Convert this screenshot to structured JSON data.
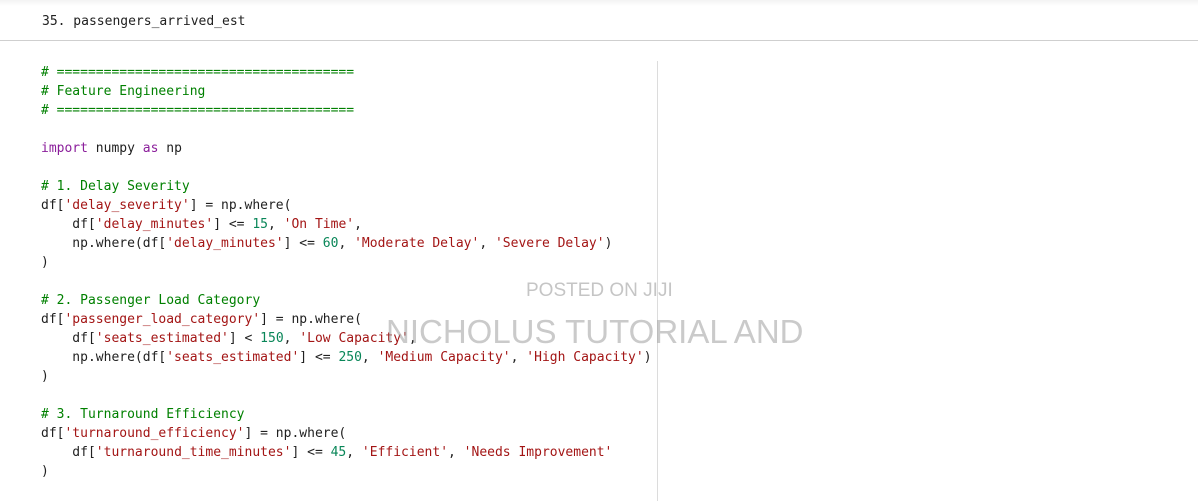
{
  "output_line": "35. passengers_arrived_est",
  "watermark": {
    "line1": "POSTED ON JIJI",
    "line2": "NICHOLUS TUTORIAL AND"
  },
  "code": [
    [
      [
        "c",
        "# ======================================"
      ]
    ],
    [
      [
        "c",
        "# Feature Engineering"
      ]
    ],
    [
      [
        "c",
        "# ======================================"
      ]
    ],
    [],
    [
      [
        "k",
        "import"
      ],
      [
        "p",
        " numpy "
      ],
      [
        "k",
        "as"
      ],
      [
        "p",
        " np"
      ]
    ],
    [],
    [
      [
        "c",
        "# 1. Delay Severity"
      ]
    ],
    [
      [
        "p",
        "df["
      ],
      [
        "s",
        "'delay_severity'"
      ],
      [
        "p",
        "] = np.where("
      ]
    ],
    [
      [
        "p",
        "    df["
      ],
      [
        "s",
        "'delay_minutes'"
      ],
      [
        "p",
        "] <= "
      ],
      [
        "n",
        "15"
      ],
      [
        "p",
        ", "
      ],
      [
        "s",
        "'On Time'"
      ],
      [
        "p",
        ","
      ]
    ],
    [
      [
        "p",
        "    np.where(df["
      ],
      [
        "s",
        "'delay_minutes'"
      ],
      [
        "p",
        "] <= "
      ],
      [
        "n",
        "60"
      ],
      [
        "p",
        ", "
      ],
      [
        "s",
        "'Moderate Delay'"
      ],
      [
        "p",
        ", "
      ],
      [
        "s",
        "'Severe Delay'"
      ],
      [
        "p",
        ")"
      ]
    ],
    [
      [
        "p",
        ")"
      ]
    ],
    [],
    [
      [
        "c",
        "# 2. Passenger Load Category"
      ]
    ],
    [
      [
        "p",
        "df["
      ],
      [
        "s",
        "'passenger_load_category'"
      ],
      [
        "p",
        "] = np.where("
      ]
    ],
    [
      [
        "p",
        "    df["
      ],
      [
        "s",
        "'seats_estimated'"
      ],
      [
        "p",
        "] < "
      ],
      [
        "n",
        "150"
      ],
      [
        "p",
        ", "
      ],
      [
        "s",
        "'Low Capacity'"
      ],
      [
        "p",
        ","
      ]
    ],
    [
      [
        "p",
        "    np.where(df["
      ],
      [
        "s",
        "'seats_estimated'"
      ],
      [
        "p",
        "] <= "
      ],
      [
        "n",
        "250"
      ],
      [
        "p",
        ", "
      ],
      [
        "s",
        "'Medium Capacity'"
      ],
      [
        "p",
        ", "
      ],
      [
        "s",
        "'High Capacity'"
      ],
      [
        "p",
        ")"
      ]
    ],
    [
      [
        "p",
        ")"
      ]
    ],
    [],
    [
      [
        "c",
        "# 3. Turnaround Efficiency"
      ]
    ],
    [
      [
        "p",
        "df["
      ],
      [
        "s",
        "'turnaround_efficiency'"
      ],
      [
        "p",
        "] = np.where("
      ]
    ],
    [
      [
        "p",
        "    df["
      ],
      [
        "s",
        "'turnaround_time_minutes'"
      ],
      [
        "p",
        "] <= "
      ],
      [
        "n",
        "45"
      ],
      [
        "p",
        ", "
      ],
      [
        "s",
        "'Efficient'"
      ],
      [
        "p",
        ", "
      ],
      [
        "s",
        "'Needs Improvement'"
      ]
    ],
    [
      [
        "p",
        ")"
      ]
    ]
  ]
}
